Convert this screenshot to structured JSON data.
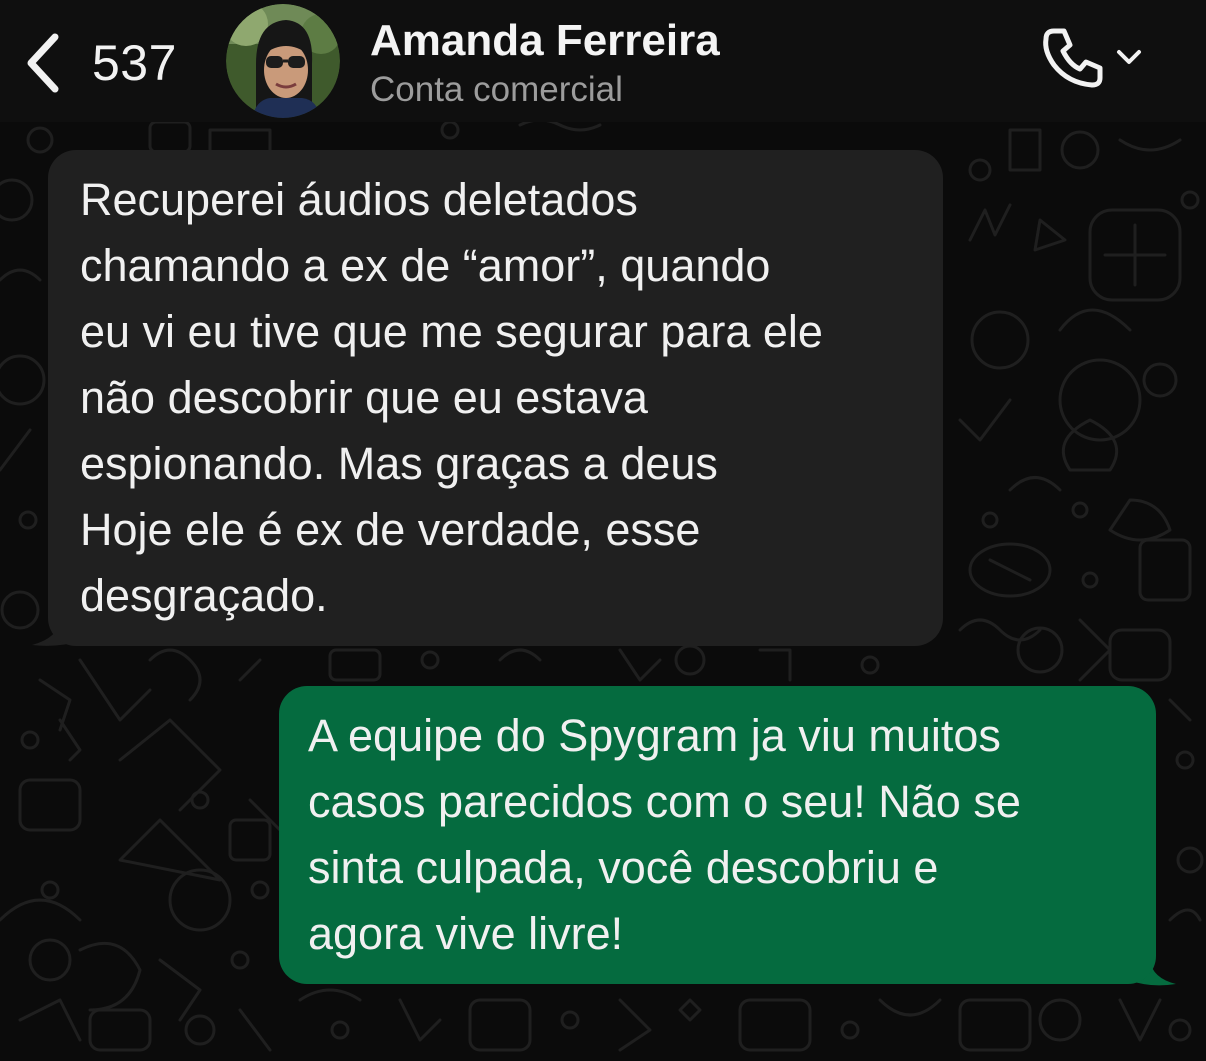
{
  "header": {
    "back_count": "537",
    "contact_name": "Amanda Ferreira",
    "contact_subtitle": "Conta comercial"
  },
  "icons": {
    "back": "chevron-left-icon",
    "call": "phone-icon",
    "call_menu": "chevron-down-icon"
  },
  "messages": [
    {
      "direction": "incoming",
      "lines": [
        "Recuperei áudios deletados",
        "chamando a ex de “amor”, quando",
        "eu vi eu tive que me segurar para ele",
        "não descobrir que eu estava",
        "espionando. Mas graças a deus",
        "Hoje ele é ex de verdade, esse",
        "desgraçado."
      ]
    },
    {
      "direction": "outgoing",
      "lines": [
        "A equipe do Spygram ja viu muitos",
        "casos parecidos com o seu! Não se",
        "sinta culpada, você descobriu e",
        "agora vive livre!"
      ]
    }
  ],
  "colors": {
    "background": "#0b0b0b",
    "header": "#0f0f0f",
    "incoming_bubble": "#202020",
    "outgoing_bubble": "#056b3f",
    "text": "#f0f0f0",
    "subtitle": "#9c9c9c"
  }
}
